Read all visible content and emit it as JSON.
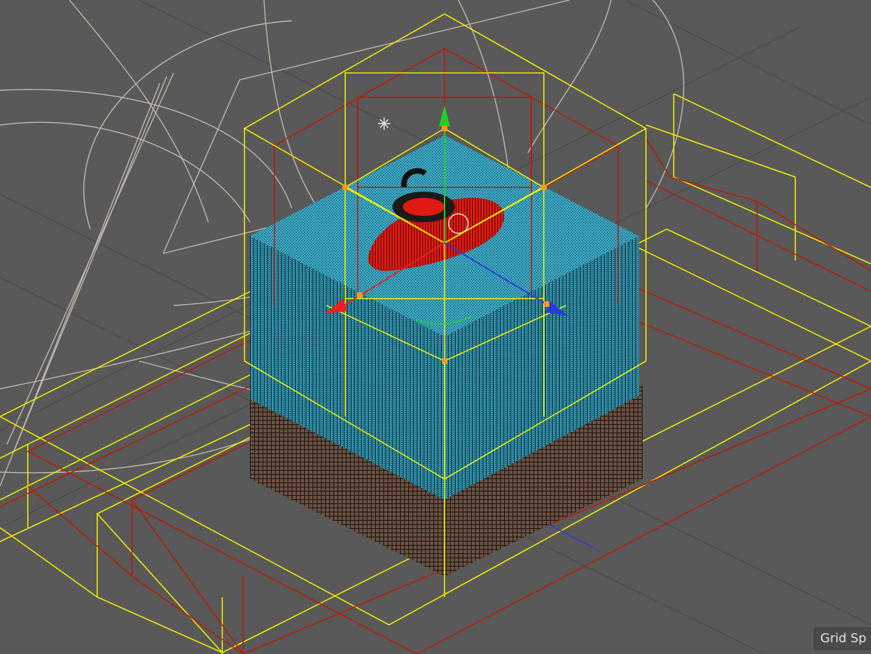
{
  "viewport": {
    "overlay_text": "Grid Sp",
    "background_color": "#595959",
    "grid_color": "#474747",
    "wire_yellow": "#f0f000",
    "wire_red": "#c01800",
    "wire_gray": "#cfc6b8",
    "water_color": "#3aa7c4",
    "soil_color": "#6a5142",
    "boat_color": "#e01a10",
    "gizmo": {
      "y_axis_color": "#22d022",
      "x_axis_color": "#e82020",
      "z_axis_color": "#2a3cd8",
      "handle_color": "#ff9a1a"
    },
    "icons": [
      "light-icon",
      "move-gizmo-icon"
    ]
  }
}
